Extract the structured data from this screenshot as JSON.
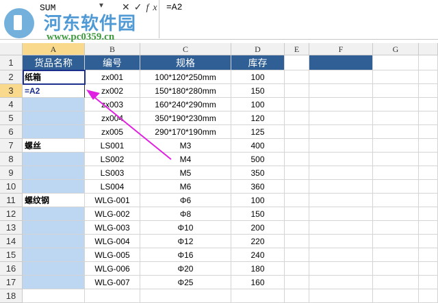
{
  "formula_bar": {
    "name_box": "SUM",
    "cancel": "✕",
    "enter": "✓",
    "fx": "fx",
    "formula": "=A2"
  },
  "watermark": {
    "title": "河东软件园",
    "url": "www.pc0359.cn"
  },
  "columns": [
    "A",
    "B",
    "C",
    "D",
    "E",
    "F",
    "G"
  ],
  "rows": [
    {
      "n": "1",
      "a": "货品名称",
      "b": "编号",
      "c": "规格",
      "d": "库存"
    },
    {
      "n": "2",
      "a": "纸箱",
      "b": "zx001",
      "c": "100*120*250mm",
      "d": "100"
    },
    {
      "n": "3",
      "a": "=A2",
      "b": "zx002",
      "c": "150*180*280mm",
      "d": "150"
    },
    {
      "n": "4",
      "a": "",
      "b": "zx003",
      "c": "160*240*290mm",
      "d": "100"
    },
    {
      "n": "5",
      "a": "",
      "b": "zx004",
      "c": "350*190*230mm",
      "d": "120"
    },
    {
      "n": "6",
      "a": "",
      "b": "zx005",
      "c": "290*170*190mm",
      "d": "125"
    },
    {
      "n": "7",
      "a": "螺丝",
      "b": "LS001",
      "c": "M3",
      "d": "400"
    },
    {
      "n": "8",
      "a": "",
      "b": "LS002",
      "c": "M4",
      "d": "500"
    },
    {
      "n": "9",
      "a": "",
      "b": "LS003",
      "c": "M5",
      "d": "350"
    },
    {
      "n": "10",
      "a": "",
      "b": "LS004",
      "c": "M6",
      "d": "360"
    },
    {
      "n": "11",
      "a": "螺纹钢",
      "b": "WLG-001",
      "c": "Φ6",
      "d": "100"
    },
    {
      "n": "12",
      "a": "",
      "b": "WLG-002",
      "c": "Φ8",
      "d": "150"
    },
    {
      "n": "13",
      "a": "",
      "b": "WLG-003",
      "c": "Φ10",
      "d": "200"
    },
    {
      "n": "14",
      "a": "",
      "b": "WLG-004",
      "c": "Φ12",
      "d": "220"
    },
    {
      "n": "15",
      "a": "",
      "b": "WLG-005",
      "c": "Φ16",
      "d": "240"
    },
    {
      "n": "16",
      "a": "",
      "b": "WLG-006",
      "c": "Φ20",
      "d": "180"
    },
    {
      "n": "17",
      "a": "",
      "b": "WLG-007",
      "c": "Φ25",
      "d": "160"
    },
    {
      "n": "18",
      "a": "",
      "b": "",
      "c": "",
      "d": ""
    }
  ],
  "colors": {
    "header": "#2f5f94",
    "blank": "#bdd7f3",
    "arrow": "#e020e0"
  }
}
